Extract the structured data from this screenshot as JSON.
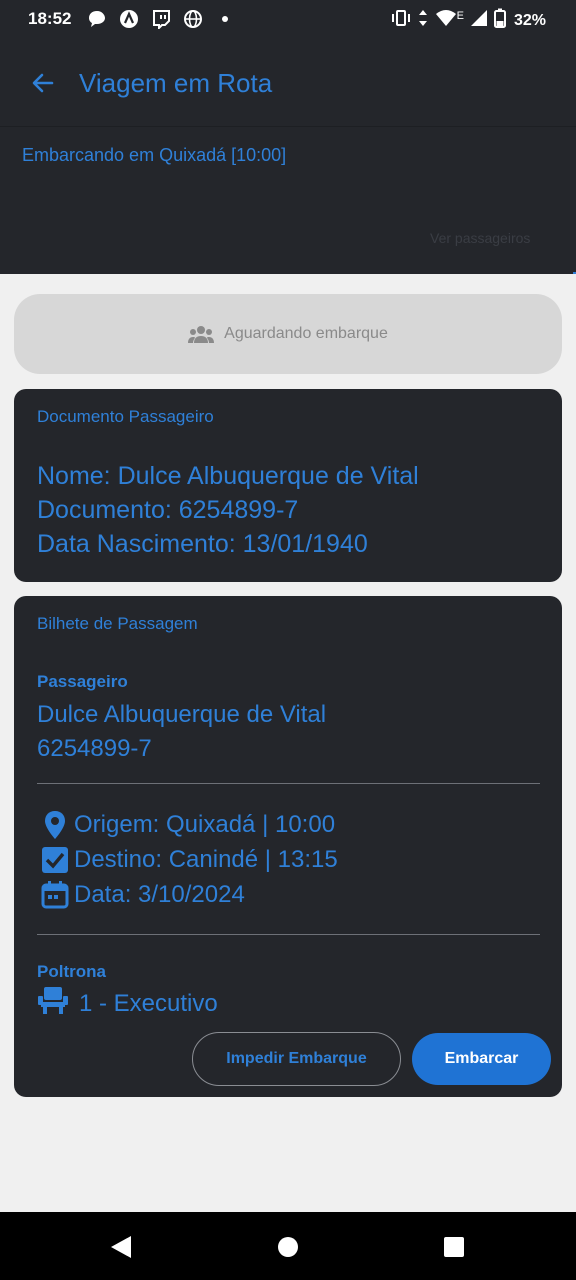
{
  "status_bar": {
    "time": "18:52",
    "battery_percent": "32%",
    "network_type": "E",
    "icons_left": [
      "chat-icon",
      "app-icon",
      "twitch-icon",
      "globe-icon",
      "dot-icon"
    ],
    "icons_right": [
      "vibrate-icon",
      "data-arrows-icon",
      "wifi-icon",
      "signal-icon",
      "battery-icon"
    ]
  },
  "header": {
    "title": "Viagem em Rota",
    "boarding_info": "Embarcando em Quixadá  [10:00]",
    "faded_link": "Ver passageiros"
  },
  "status_pill": {
    "label": "Aguardando embarque",
    "icon": "group-icon"
  },
  "document_card": {
    "heading": "Documento Passageiro",
    "name_line": "Nome: Dulce Albuquerque de Vital",
    "document_line": "Documento: 6254899-7",
    "birth_line": "Data Nascimento: 13/01/1940"
  },
  "ticket_card": {
    "heading": "Bilhete de Passagem",
    "passenger_label": "Passageiro",
    "passenger_name": "Dulce Albuquerque de Vital",
    "passenger_document": "6254899-7",
    "origin_line": "Origem: Quixadá  | 10:00",
    "destination_line": "Destino: Canindé  | 13:15",
    "date_line": "Data: 3/10/2024",
    "seat_label": "Poltrona",
    "seat_value": "1 - Executivo",
    "deny_button": "Impedir Embarque",
    "board_button": "Embarcar"
  },
  "colors": {
    "accent": "#2f80d8",
    "card_bg": "#24262b",
    "primary_button": "#1f73d4",
    "page_bg": "#f0f0f0"
  }
}
